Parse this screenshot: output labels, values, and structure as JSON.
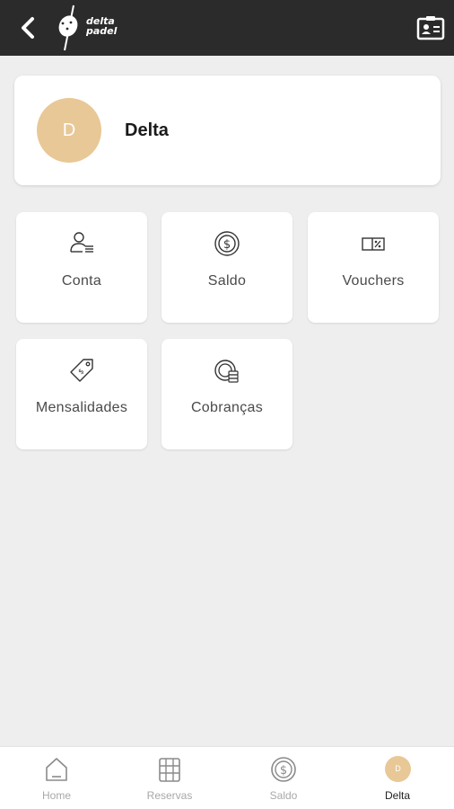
{
  "header": {
    "logo_line1": "delta",
    "logo_line2": "padel",
    "back_icon": "chevron-left-icon",
    "id_card_icon": "id-card-icon",
    "background": "#2b2b2b"
  },
  "profile": {
    "initial": "D",
    "name": "Delta",
    "avatar_color": "#e8c896"
  },
  "menu": [
    {
      "label": "Conta",
      "icon": "user-list-icon"
    },
    {
      "label": "Saldo",
      "icon": "coin-dollar-icon"
    },
    {
      "label": "Vouchers",
      "icon": "voucher-icon"
    },
    {
      "label": "Mensalidades",
      "icon": "price-tag-icon"
    },
    {
      "label": "Cobranças",
      "icon": "coins-icon"
    }
  ],
  "bottom_nav": [
    {
      "label": "Home",
      "icon": "home-icon",
      "active": false
    },
    {
      "label": "Reservas",
      "icon": "calendar-film-icon",
      "active": false
    },
    {
      "label": "Saldo",
      "icon": "coin-dollar-icon",
      "active": false
    },
    {
      "label": "Delta",
      "icon": "avatar",
      "initial": "D",
      "active": true
    }
  ]
}
